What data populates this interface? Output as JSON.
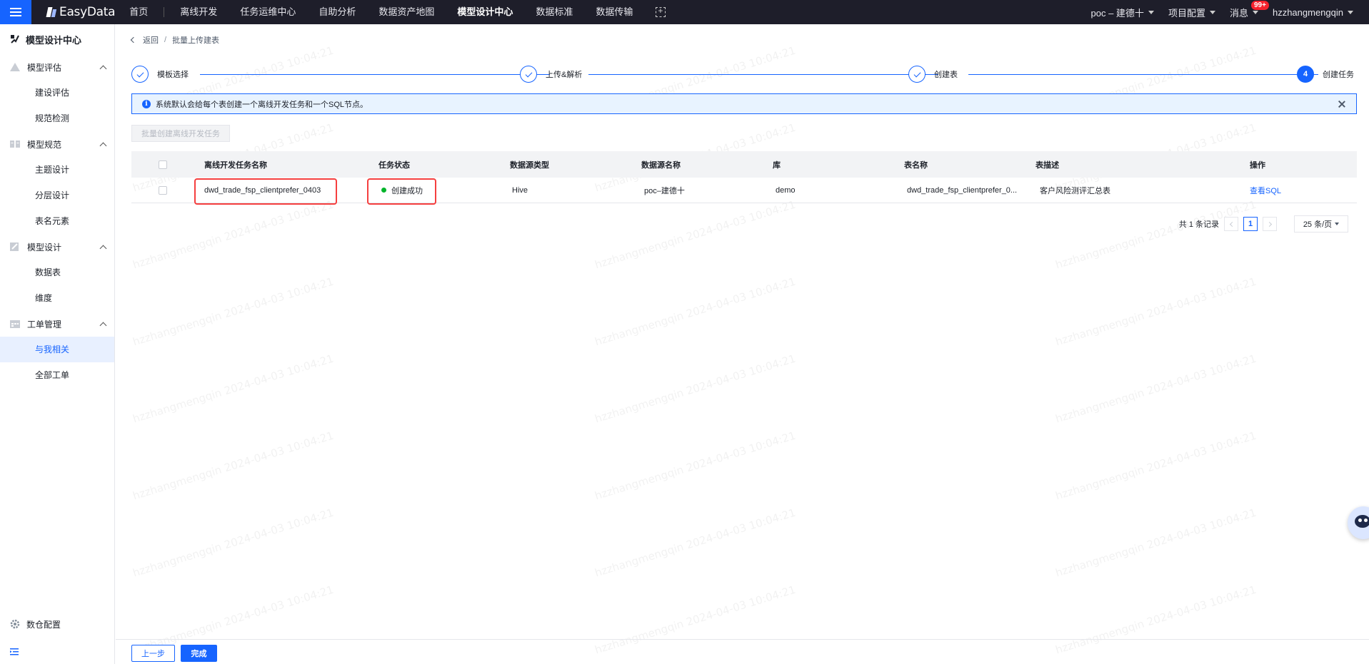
{
  "topbar": {
    "logo": "EasyData",
    "nav": [
      "首页",
      "离线开发",
      "任务运维中心",
      "自助分析",
      "数据资产地图",
      "模型设计中心",
      "数据标准",
      "数据传输"
    ],
    "active_nav": "模型设计中心",
    "project": "poc – 建德十",
    "project_config": "项目配置",
    "messages": "消息",
    "message_badge": "99+",
    "user": "hzzhangmengqin"
  },
  "sidebar": {
    "title": "模型设计中心",
    "groups": [
      {
        "label": "模型评估",
        "items": [
          "建设评估",
          "规范检测"
        ]
      },
      {
        "label": "模型规范",
        "items": [
          "主题设计",
          "分层设计",
          "表名元素"
        ]
      },
      {
        "label": "模型设计",
        "items": [
          "数据表",
          "维度"
        ]
      },
      {
        "label": "工单管理",
        "items": [
          "与我相关",
          "全部工单"
        ]
      }
    ],
    "active_item": "与我相关",
    "bottom": "数仓配置"
  },
  "breadcrumb": {
    "back": "返回",
    "sep": "/",
    "current": "批量上传建表"
  },
  "steps": [
    {
      "label": "模板选择",
      "status": "done"
    },
    {
      "label": "上传&解析",
      "status": "done"
    },
    {
      "label": "创建表",
      "status": "done"
    },
    {
      "label": "创建任务",
      "status": "current",
      "number": "4"
    }
  ],
  "alert": {
    "text": "系统默认会给每个表创建一个离线开发任务和一个SQL节点。"
  },
  "batch_button": "批量创建离线开发任务",
  "table": {
    "columns": [
      "离线开发任务名称",
      "任务状态",
      "数据源类型",
      "数据源名称",
      "库",
      "表名称",
      "表描述",
      "操作"
    ],
    "rows": [
      {
        "task_name": "dwd_trade_fsp_clientprefer_0403",
        "status": "创建成功",
        "source_type": "Hive",
        "source_name": "poc–建德十",
        "db": "demo",
        "table_name": "dwd_trade_fsp_clientprefer_0...",
        "table_desc": "客户风险测评汇总表",
        "action": "查看SQL"
      }
    ]
  },
  "pager": {
    "total": "共 1 条记录",
    "page": "1",
    "page_size": "25 条/页"
  },
  "footer": {
    "prev": "上一步",
    "done": "完成"
  },
  "watermark": "hzzhangmengqin 2024-04-03 10:04:21",
  "colors": {
    "primary": "#1664ff",
    "success": "#00b42a",
    "highlight": "#f53f3f",
    "topbar": "#1e1e2a"
  }
}
